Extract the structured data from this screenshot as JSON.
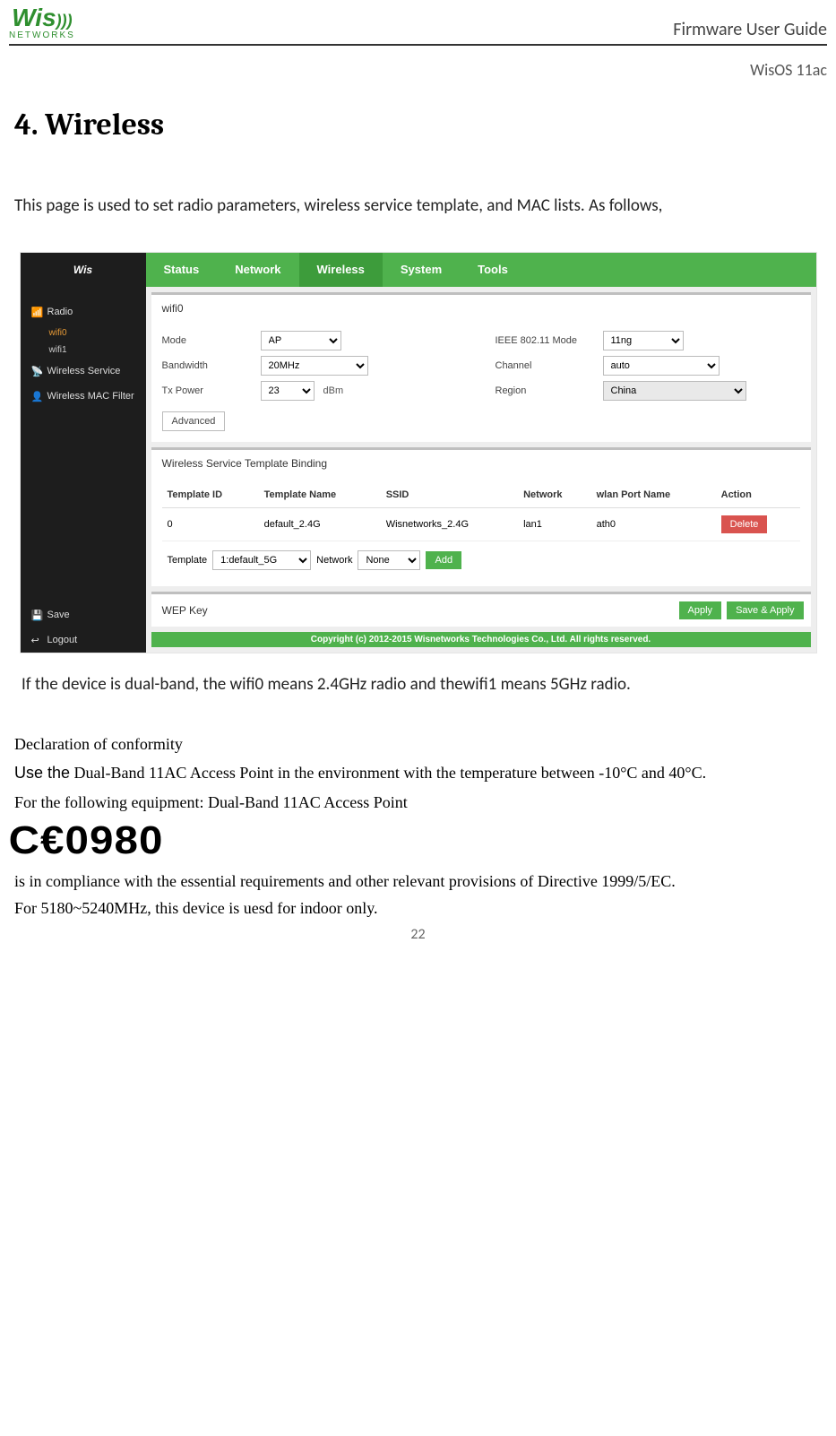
{
  "header": {
    "brand": "Wis",
    "brand_sub": "NETWORKS",
    "title_right": "Firmware User Guide",
    "subtitle_right": "WisOS 11ac"
  },
  "section_title": "4. Wireless",
  "intro": "This page is used to set radio parameters, wireless service template, and MAC lists. As follows,",
  "screenshot": {
    "logo_text": "Wis",
    "nav": [
      "Status",
      "Network",
      "Wireless",
      "System",
      "Tools"
    ],
    "nav_active_index": 2,
    "sidebar": {
      "radio": "Radio",
      "wifi0": "wifi0",
      "wifi1": "wifi1",
      "wireless_service": "Wireless Service",
      "mac_filter": "Wireless MAC Filter",
      "save": "Save",
      "logout": "Logout"
    },
    "card1": {
      "title": "wifi0",
      "mode_label": "Mode",
      "mode_value": "AP",
      "ieee_label": "IEEE 802.11 Mode",
      "ieee_value": "11ng",
      "bw_label": "Bandwidth",
      "bw_value": "20MHz",
      "ch_label": "Channel",
      "ch_value": "auto",
      "tx_label": "Tx Power",
      "tx_value": "23",
      "tx_unit": "dBm",
      "region_label": "Region",
      "region_value": "China",
      "advanced": "Advanced"
    },
    "card2": {
      "title": "Wireless Service Template Binding",
      "cols": [
        "Template ID",
        "Template Name",
        "SSID",
        "Network",
        "wlan Port Name",
        "Action"
      ],
      "row": [
        "0",
        "default_2.4G",
        "Wisnetworks_2.4G",
        "lan1",
        "ath0"
      ],
      "delete": "Delete",
      "tpl_label": "Template",
      "tpl_value": "1:default_5G",
      "net_label": "Network",
      "net_value": "None",
      "add": "Add"
    },
    "card3": {
      "title": "WEP Key",
      "apply": "Apply",
      "save_apply": "Save & Apply"
    },
    "copyright": "Copyright (c) 2012-2015 Wisnetworks Technologies Co., Ltd. All rights reserved."
  },
  "after_shot": "If the device is dual-band, the wifi0 means 2.4GHz radio and thewifi1 means 5GHz radio.",
  "declaration": {
    "heading": "Declaration of conformity",
    "use_prefix": "Use the",
    "use_rest": " Dual-Band 11AC Access Point in the environment with the temperature between -10°C and 40°C.",
    "equip": "For the following equipment: Dual-Band 11AC Access Point",
    "ce": "C€0980",
    "compliance": "is in compliance with the essential requirements and other relevant provisions of Directive 1999/5/EC.",
    "indoor": "For 5180~5240MHz, this device is uesd for indoor only."
  },
  "page_number": "22"
}
